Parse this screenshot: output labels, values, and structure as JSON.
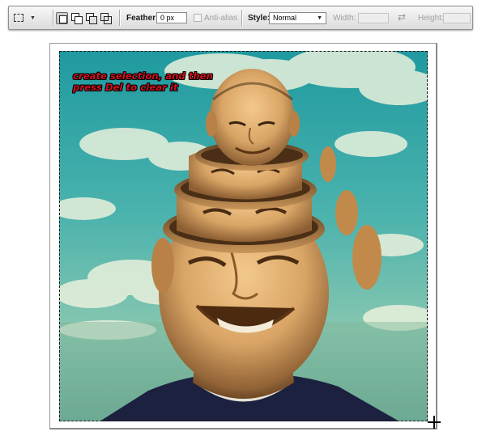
{
  "options_bar": {
    "tool_preset_icon": "rectangular-marquee-icon",
    "selection_modes": [
      {
        "name": "new-selection",
        "active": true
      },
      {
        "name": "add-to-selection",
        "active": false
      },
      {
        "name": "subtract-from-selection",
        "active": false
      },
      {
        "name": "intersect-with-selection",
        "active": false
      }
    ],
    "feather_label": "Feather:",
    "feather_value": "0 px",
    "anti_alias_label": "Anti-alias",
    "anti_alias_checked": false,
    "style_label": "Style:",
    "style_value": "Normal",
    "width_label": "Width:",
    "width_value": "",
    "swap_icon": "swap-arrows-icon",
    "height_label": "Height:",
    "height_value": ""
  },
  "canvas": {
    "annotation_line1": "create selection, and then",
    "annotation_line2": "press Del to clear it",
    "annotation_color": "#d4101e",
    "photo_description_icon": "stacked-heads-photo",
    "cursor_icon": "crosshair-cursor-icon"
  },
  "colors": {
    "toolbar_bg": "#e6e6e6",
    "sky_teal": "#2aa6a6",
    "shirt_navy": "#1c2140"
  }
}
